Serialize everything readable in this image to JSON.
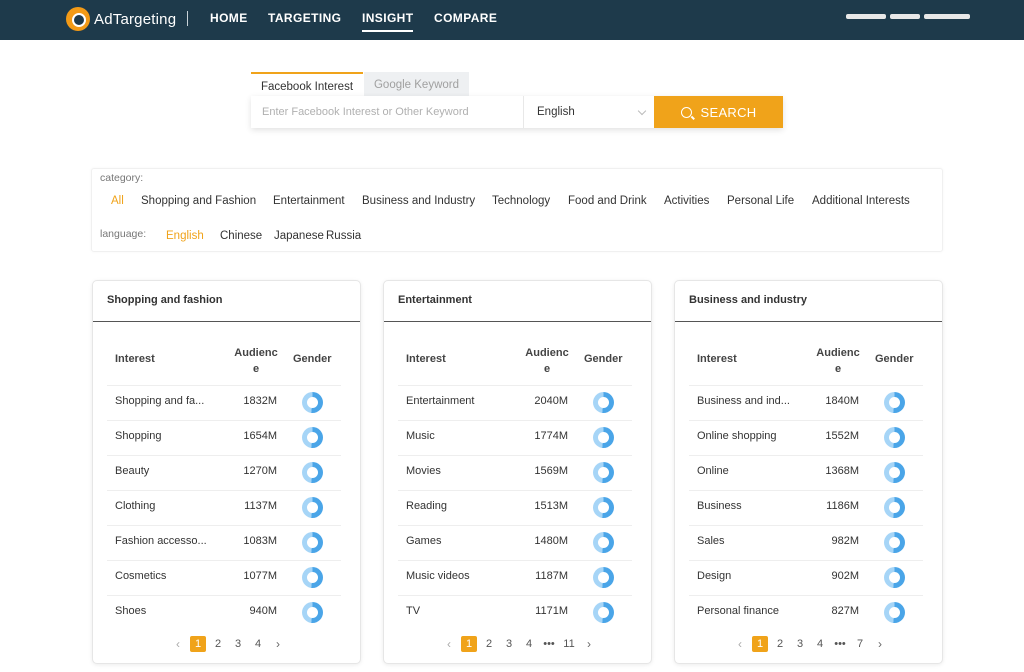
{
  "header": {
    "logo_text": "AdTargeting",
    "nav": [
      "HOME",
      "TARGETING",
      "INSIGHT",
      "COMPARE"
    ],
    "active_nav": "INSIGHT"
  },
  "search": {
    "tabs": [
      "Facebook Interest",
      "Google Keyword"
    ],
    "placeholder": "Enter Facebook Interest or Other Keyword",
    "language": "English",
    "button": "SEARCH"
  },
  "filters": {
    "category_label": "category:",
    "categories": [
      "All",
      "Shopping and Fashion",
      "Entertainment",
      "Business and Industry",
      "Technology",
      "Food and Drink",
      "Activities",
      "Personal Life",
      "Additional Interests"
    ],
    "language_label": "language:",
    "languages": [
      "English",
      "Chinese",
      "Japanese",
      "Russia"
    ]
  },
  "table_headers": {
    "interest": "Interest",
    "audience": "Audienc e",
    "gender": "Gender"
  },
  "cards": [
    {
      "title": "Shopping and fashion",
      "rows": [
        {
          "name": "Shopping and fa...",
          "audience": "1832M"
        },
        {
          "name": "Shopping",
          "audience": "1654M"
        },
        {
          "name": "Beauty",
          "audience": "1270M"
        },
        {
          "name": "Clothing",
          "audience": "1137M"
        },
        {
          "name": "Fashion accesso...",
          "audience": "1083M"
        },
        {
          "name": "Cosmetics",
          "audience": "1077M"
        },
        {
          "name": "Shoes",
          "audience": "940M"
        }
      ],
      "pages": [
        "1",
        "2",
        "3",
        "4"
      ]
    },
    {
      "title": "Entertainment",
      "rows": [
        {
          "name": "Entertainment",
          "audience": "2040M"
        },
        {
          "name": "Music",
          "audience": "1774M"
        },
        {
          "name": "Movies",
          "audience": "1569M"
        },
        {
          "name": "Reading",
          "audience": "1513M"
        },
        {
          "name": "Games",
          "audience": "1480M"
        },
        {
          "name": "Music videos",
          "audience": "1187M"
        },
        {
          "name": "TV",
          "audience": "1171M"
        }
      ],
      "pages": [
        "1",
        "2",
        "3",
        "4",
        "•••",
        "11"
      ]
    },
    {
      "title": "Business and industry",
      "rows": [
        {
          "name": "Business and ind...",
          "audience": "1840M"
        },
        {
          "name": "Online shopping",
          "audience": "1552M"
        },
        {
          "name": "Online",
          "audience": "1368M"
        },
        {
          "name": "Business",
          "audience": "1186M"
        },
        {
          "name": "Sales",
          "audience": "982M"
        },
        {
          "name": "Design",
          "audience": "902M"
        },
        {
          "name": "Personal finance",
          "audience": "827M"
        }
      ],
      "pages": [
        "1",
        "2",
        "3",
        "4",
        "•••",
        "7"
      ]
    }
  ],
  "colors": {
    "header_bg": "#1e3a4b",
    "accent": "#f0a31a",
    "donut": "#4aa5e8"
  },
  "icons": {
    "search": "search-icon",
    "prev": "chevron-left-icon",
    "next": "chevron-right-icon",
    "gender": "donut-chart-icon"
  }
}
